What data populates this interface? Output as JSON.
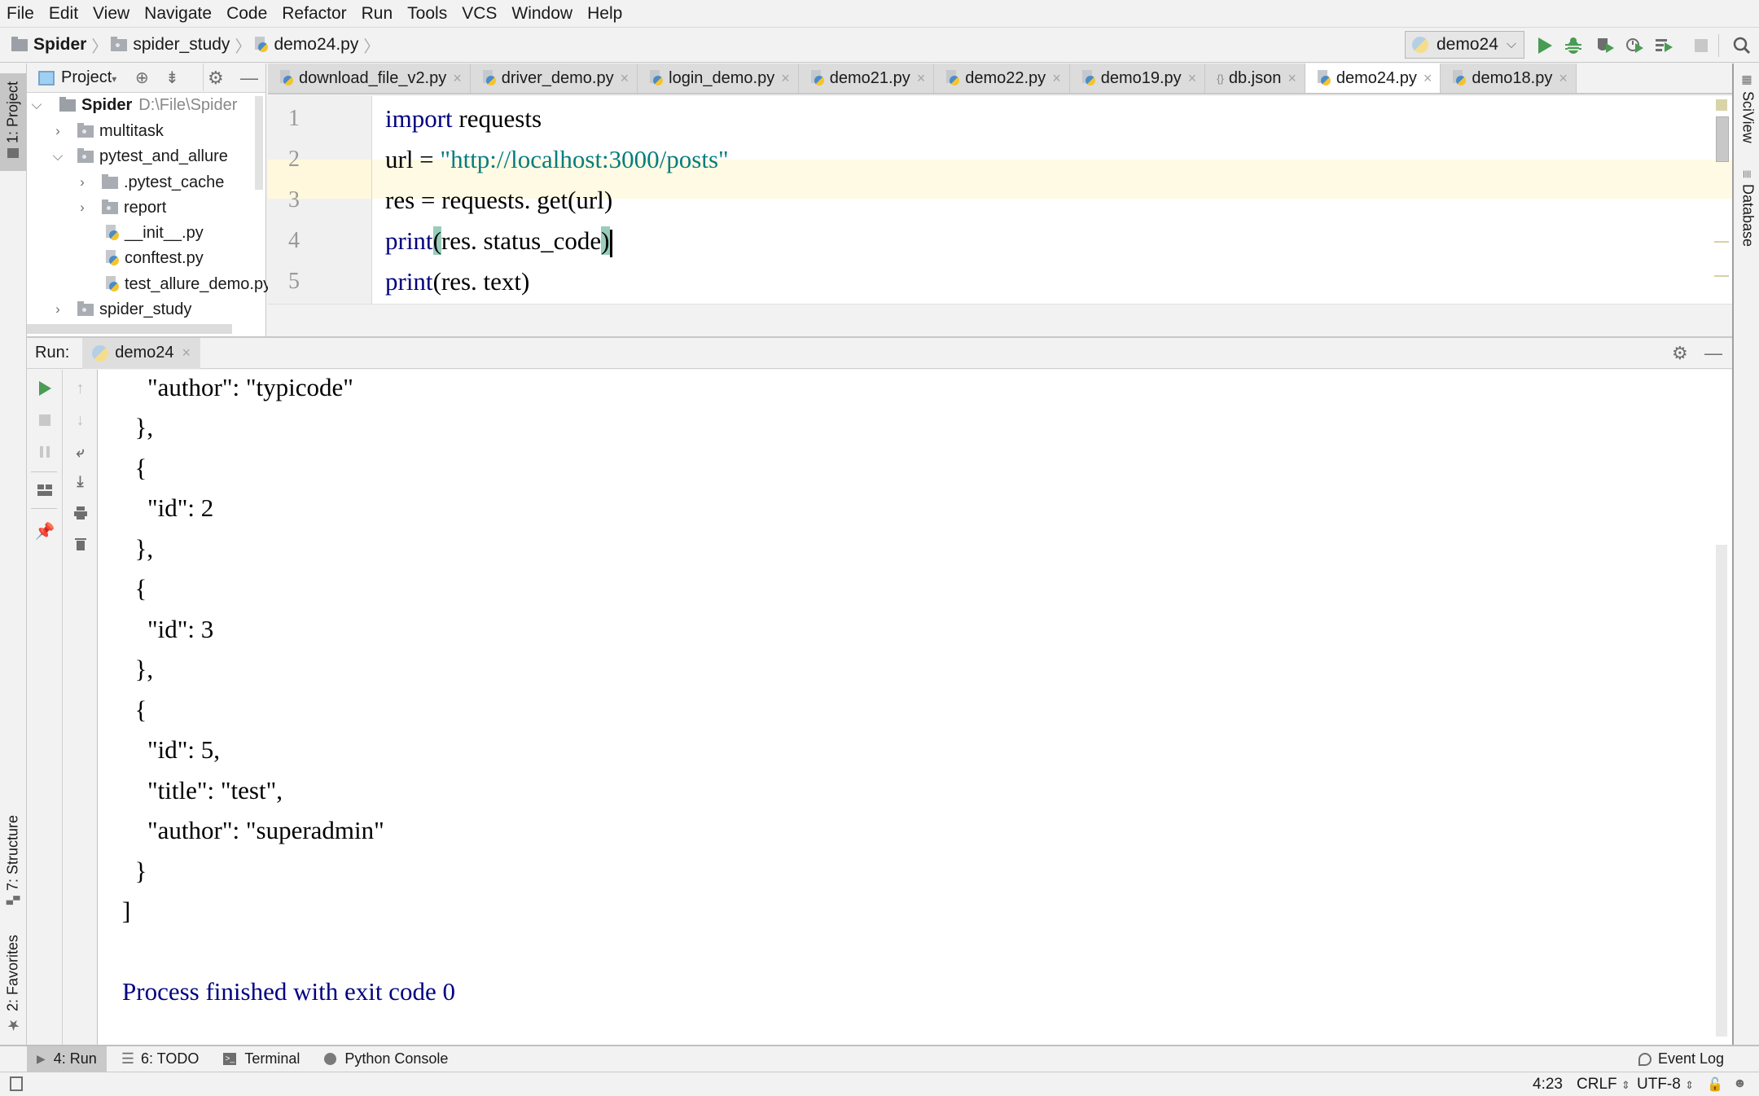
{
  "menu": [
    "File",
    "Edit",
    "View",
    "Navigate",
    "Code",
    "Refactor",
    "Run",
    "Tools",
    "VCS",
    "Window",
    "Help"
  ],
  "breadcrumb": [
    "Spider",
    "spider_study",
    "demo24.py"
  ],
  "run_config": {
    "name": "demo24"
  },
  "toolbar_icons": [
    "run-icon",
    "debug-icon",
    "coverage-icon",
    "profile-icon",
    "concurrency-icon",
    "stop-icon",
    "search-icon"
  ],
  "project_panel": {
    "title": "Project",
    "tree": [
      {
        "label": "Spider",
        "path": "D:\\File\\Spider",
        "type": "folder",
        "expanded": true
      },
      {
        "label": "multitask",
        "type": "package",
        "expanded": false
      },
      {
        "label": "pytest_and_allure",
        "type": "package",
        "expanded": true
      },
      {
        "label": ".pytest_cache",
        "type": "folder",
        "expanded": false
      },
      {
        "label": "report",
        "type": "package",
        "expanded": false
      },
      {
        "label": "__init__.py",
        "type": "python"
      },
      {
        "label": "conftest.py",
        "type": "python"
      },
      {
        "label": "test_allure_demo.py",
        "type": "python"
      },
      {
        "label": "spider_study",
        "type": "package",
        "expanded": false
      }
    ]
  },
  "editor_tabs": [
    {
      "label": "download_file_v2.py",
      "active": false
    },
    {
      "label": "driver_demo.py",
      "active": false
    },
    {
      "label": "login_demo.py",
      "active": false
    },
    {
      "label": "demo21.py",
      "active": false
    },
    {
      "label": "demo22.py",
      "active": false
    },
    {
      "label": "demo19.py",
      "active": false
    },
    {
      "label": "db.json",
      "active": false
    },
    {
      "label": "demo24.py",
      "active": true
    },
    {
      "label": "demo18.py",
      "active": false
    }
  ],
  "editor": {
    "line_numbers": [
      "1",
      "2",
      "3",
      "4",
      "5"
    ],
    "lines": {
      "l1_kw": "import",
      "l1_rest": " requests",
      "l2_pre": "url = ",
      "l2_str": "\"http://localhost:3000/posts\"",
      "l3": "res = requests. get(url)",
      "l4_pre": "print",
      "l4_open": "(",
      "l4_mid": "res. status_code",
      "l4_close": ")",
      "l5": "print(res. text)"
    },
    "current_line": 4
  },
  "run_panel": {
    "label": "Run:",
    "tab": "demo24",
    "output": [
      "    \"author\": \"typicode\"",
      "  },",
      "  {",
      "    \"id\": 2",
      "  },",
      "  {",
      "    \"id\": 3",
      "  },",
      "  {",
      "    \"id\": 5,",
      "    \"title\": \"test\",",
      "    \"author\": \"superadmin\"",
      "  }",
      "]",
      "",
      "Process finished with exit code 0"
    ]
  },
  "left_stripe": {
    "project": "1: Project",
    "structure": "7: Structure",
    "favorites": "2: Favorites"
  },
  "right_stripe": {
    "sciview": "SciView",
    "database": "Database"
  },
  "bottom_tools": [
    {
      "label": "4: Run",
      "active": true
    },
    {
      "label": "6: TODO",
      "active": false
    },
    {
      "label": "Terminal",
      "active": false
    },
    {
      "label": "Python Console",
      "active": false
    }
  ],
  "event_log": "Event Log",
  "status": {
    "position": "4:23",
    "line_sep": "CRLF",
    "encoding": "UTF-8"
  },
  "colors": {
    "run_green": "#499c54",
    "keyword": "#000080",
    "string": "#067d7f",
    "current_line": "#fffae3",
    "brace_match": "#99ccbb"
  }
}
